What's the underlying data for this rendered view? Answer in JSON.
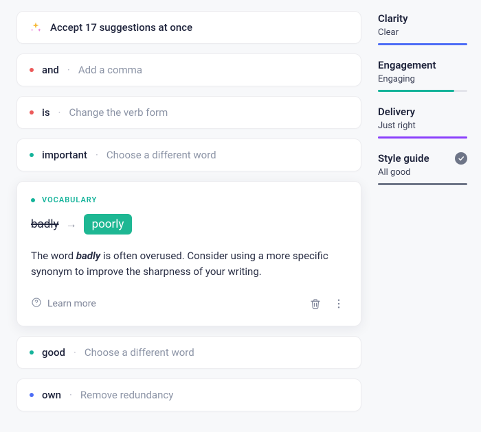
{
  "accept_all": {
    "label": "Accept 17 suggestions at once"
  },
  "suggestions": [
    {
      "word": "and",
      "action": "Add a comma",
      "bullet": "red"
    },
    {
      "word": "is",
      "action": "Change the verb form",
      "bullet": "red"
    },
    {
      "word": "important",
      "action": "Choose a different word",
      "bullet": "teal"
    }
  ],
  "expanded": {
    "category": "VOCABULARY",
    "original": "badly",
    "replacement": "poorly",
    "explanation_pre": "The word ",
    "explanation_bold": "badly",
    "explanation_post": " is often overused. Consider using a more specific synonym to improve the sharpness of your writing.",
    "learn_more": "Learn more"
  },
  "suggestions_after": [
    {
      "word": "good",
      "action": "Choose a different word",
      "bullet": "teal"
    },
    {
      "word": "own",
      "action": "Remove redundancy",
      "bullet": "blue"
    }
  ],
  "sidebar": {
    "clarity": {
      "title": "Clarity",
      "value": "Clear"
    },
    "engagement": {
      "title": "Engagement",
      "value": "Engaging"
    },
    "delivery": {
      "title": "Delivery",
      "value": "Just right"
    },
    "styleguide": {
      "title": "Style guide",
      "value": "All good"
    }
  }
}
